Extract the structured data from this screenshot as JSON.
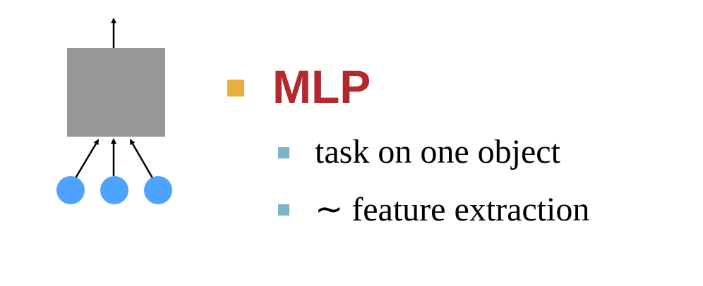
{
  "colors": {
    "title": "#b3282d",
    "main_bullet": "#e8b040",
    "sub_bullet": "#7fb3c8",
    "node_fill": "#4da3ff",
    "box_fill": "#979797",
    "arrow": "#000000"
  },
  "slide": {
    "title": "MLP",
    "bullets": [
      "task on one object",
      "∼ feature extraction"
    ]
  },
  "diagram": {
    "input_node_count": 3,
    "icons": [
      "square-bullet-icon",
      "square-bullet-icon"
    ]
  }
}
